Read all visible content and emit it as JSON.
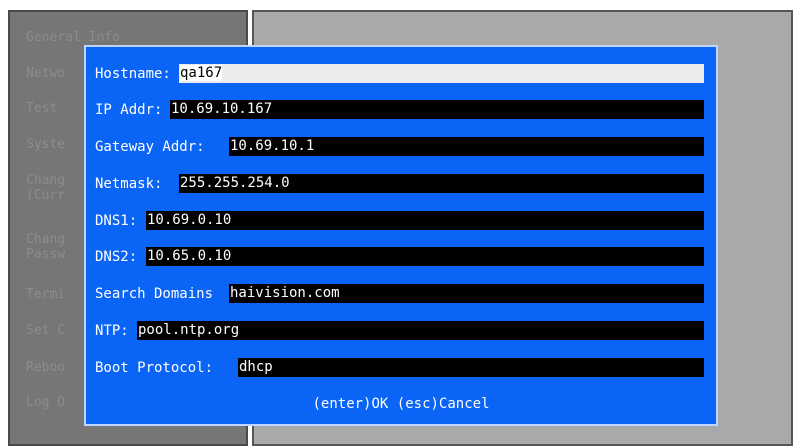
{
  "background_menu": {
    "items": [
      "General Info",
      "Netwo",
      "Test",
      "Syste",
      "Chang\n(Curr",
      "Chang\nPassw",
      "Termi",
      "Set C",
      "Reboo",
      "Log O"
    ]
  },
  "dialog": {
    "fields": [
      {
        "label": "Hostname: ",
        "value": "qa167"
      },
      {
        "label": "IP Addr: ",
        "value": "10.69.10.167"
      },
      {
        "label": "Gateway Addr: ",
        "value": "10.69.10.1"
      },
      {
        "label": "Netmask: ",
        "value": "255.255.254.0"
      },
      {
        "label": "DNS1: ",
        "value": "10.69.0.10"
      },
      {
        "label": "DNS2: ",
        "value": "10.65.0.10"
      },
      {
        "label": "Search Domains",
        "value": "haivision.com"
      },
      {
        "label": "NTP: ",
        "value": "pool.ntp.org"
      },
      {
        "label": "Boot Protocol: ",
        "value": "dhcp"
      }
    ],
    "ok_label": "(enter)OK",
    "cancel_label": "(esc)Cancel"
  },
  "colors": {
    "dialog_bg": "#0a64f5",
    "field_bg": "#000000",
    "active_field_bg": "#ececec"
  }
}
